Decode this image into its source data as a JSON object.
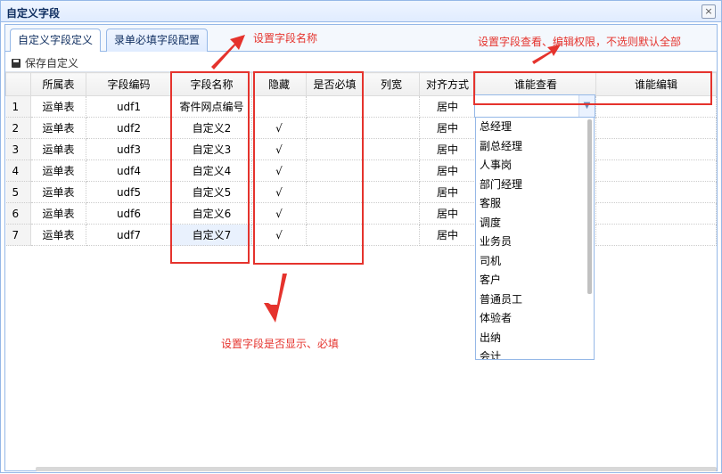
{
  "window": {
    "title": "自定义字段",
    "close_label": "×"
  },
  "tabs": [
    {
      "label": "自定义字段定义"
    },
    {
      "label": "录单必填字段配置"
    }
  ],
  "toolbar": {
    "save_label": "保存自定义"
  },
  "grid": {
    "columns": [
      "所属表",
      "字段编码",
      "字段名称",
      "隐藏",
      "是否必填",
      "列宽",
      "对齐方式",
      "谁能查看",
      "谁能编辑"
    ],
    "rows": [
      {
        "num": "1",
        "table": "运单表",
        "code": "udf1",
        "name": "寄件网点编号",
        "hidden": "",
        "required": "",
        "width": "",
        "align": "居中"
      },
      {
        "num": "2",
        "table": "运单表",
        "code": "udf2",
        "name": "自定义2",
        "hidden": "√",
        "required": "",
        "width": "",
        "align": "居中"
      },
      {
        "num": "3",
        "table": "运单表",
        "code": "udf3",
        "name": "自定义3",
        "hidden": "√",
        "required": "",
        "width": "",
        "align": "居中"
      },
      {
        "num": "4",
        "table": "运单表",
        "code": "udf4",
        "name": "自定义4",
        "hidden": "√",
        "required": "",
        "width": "",
        "align": "居中"
      },
      {
        "num": "5",
        "table": "运单表",
        "code": "udf5",
        "name": "自定义5",
        "hidden": "√",
        "required": "",
        "width": "",
        "align": "居中"
      },
      {
        "num": "6",
        "table": "运单表",
        "code": "udf6",
        "name": "自定义6",
        "hidden": "√",
        "required": "",
        "width": "",
        "align": "居中"
      },
      {
        "num": "7",
        "table": "运单表",
        "code": "udf7",
        "name": "自定义7",
        "hidden": "√",
        "required": "",
        "width": "",
        "align": "居中"
      }
    ]
  },
  "dropdown": {
    "options": [
      "总经理",
      "副总经理",
      "人事岗",
      "部门经理",
      "客服",
      "调度",
      "业务员",
      "司机",
      "客户",
      "普通员工",
      "体验者",
      "出纳",
      "会计"
    ]
  },
  "annotations": {
    "field_name": "设置字段名称",
    "visibility_required": "设置字段是否显示、必填",
    "permissions": "设置字段查看、编辑权限，不选则默认全部"
  },
  "colors": {
    "annotation": "#e5332d",
    "border": "#95b8e7",
    "selected_cell": "#e9f1fd"
  }
}
